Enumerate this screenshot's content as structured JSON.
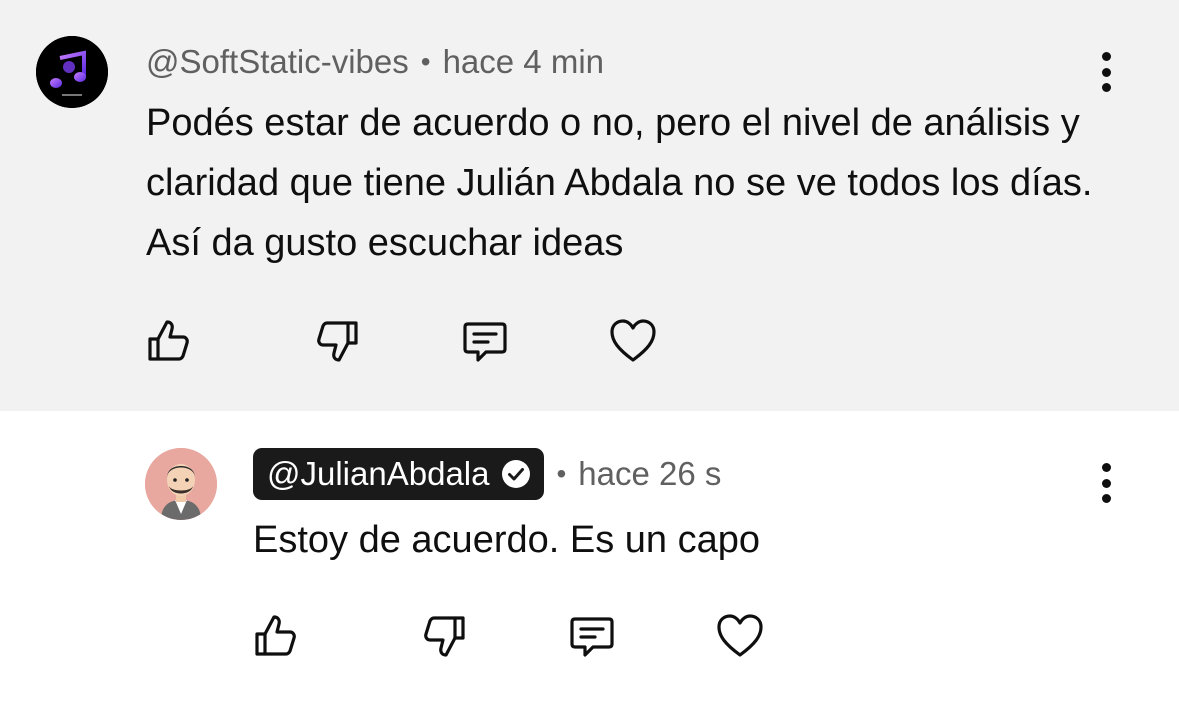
{
  "comments": [
    {
      "handle": "@SoftStatic-vibes",
      "separator": "•",
      "time": "hace 4 min",
      "text": "Podés estar de acuerdo o no, pero el nivel de análisis y claridad que tiene Julián Abdala no se ve todos los días. Así da gusto escuchar ideas",
      "avatar_icon": "music-notes-logo-avatar",
      "verified": false,
      "actions": [
        "thumbs-up-icon",
        "thumbs-down-icon",
        "reply-icon",
        "heart-icon"
      ]
    },
    {
      "handle": "@JulianAbdala",
      "separator": "•",
      "time": "hace 26 s",
      "text": "Estoy de acuerdo. Es un capo",
      "avatar_icon": "cartoon-person-avatar",
      "verified": true,
      "actions": [
        "thumbs-up-icon",
        "thumbs-down-icon",
        "reply-icon",
        "heart-icon"
      ]
    }
  ],
  "colors": {
    "highlight_background": "#f2f2f2",
    "background": "#ffffff",
    "text": "#0f0f0f",
    "meta_text": "#606060",
    "creator_badge": "#1a1a1a"
  }
}
